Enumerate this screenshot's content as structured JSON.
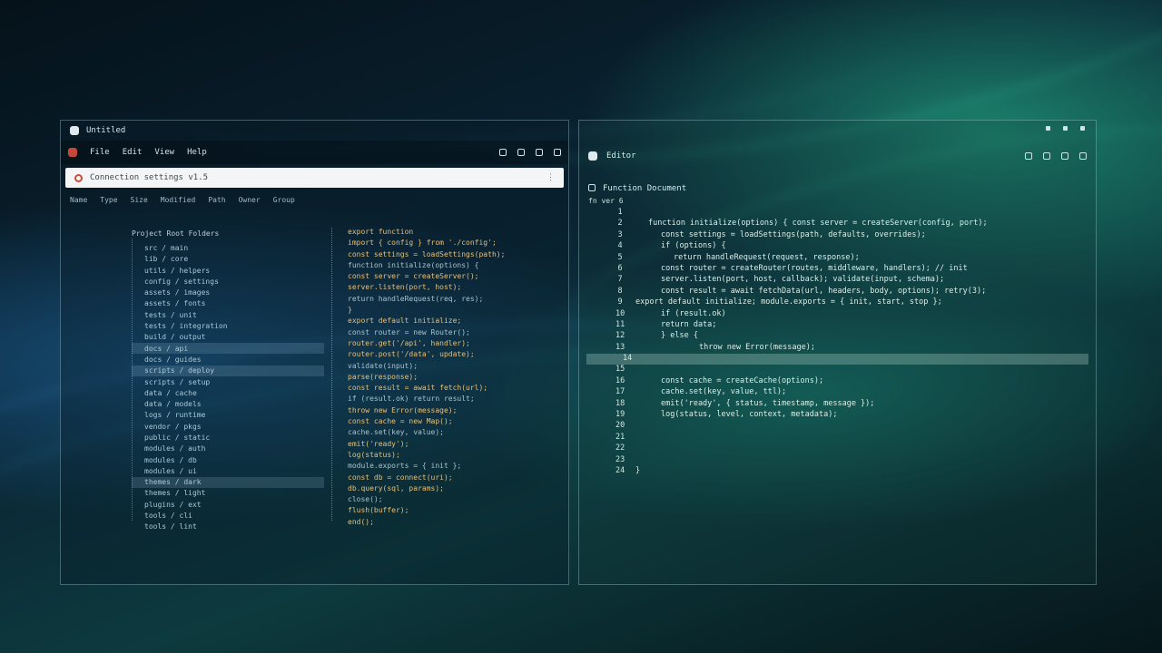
{
  "left_window": {
    "title": "Untitled",
    "menu": [
      "File",
      "Edit",
      "View",
      "Help"
    ],
    "address": "Connection settings   v1.5",
    "address_menu": "⋮",
    "toolbar": [
      "Name",
      "Type",
      "Size",
      "Modified",
      "Path",
      "Owner",
      "Group"
    ],
    "tree_header": "Project  Root  Folders",
    "tree_rows": [
      "src / main",
      "lib / core",
      "utils / helpers",
      "config / settings",
      "assets / images",
      "assets / fonts",
      "tests / unit",
      "tests / integration",
      "build / output",
      "docs / api",
      "docs / guides",
      "scripts / deploy",
      "scripts / setup",
      "data / cache",
      "data / models",
      "logs / runtime",
      "vendor / pkgs",
      "public / static",
      "modules / auth",
      "modules / db",
      "modules / ui",
      "themes / dark",
      "themes / light",
      "plugins / ext",
      "tools / cli",
      "tools / lint"
    ],
    "selected_tree_rows": [
      9,
      11,
      21
    ],
    "code_header": "export function",
    "code_lines": [
      "import { config } from './config';",
      "const settings = loadSettings(path);",
      "function initialize(options) {",
      "  const server = createServer();",
      "  server.listen(port, host);",
      "  return handleRequest(req, res);",
      "}",
      "export default initialize;",
      "const router = new Router();",
      "router.get('/api', handler);",
      "router.post('/data', update);",
      "  validate(input);",
      "  parse(response);",
      "  const result = await fetch(url);",
      "if (result.ok) return result;",
      "  throw new Error(message);",
      "const cache = new Map();",
      "cache.set(key, value);",
      "  emit('ready');",
      "  log(status);",
      "module.exports = { init };",
      "  const db = connect(uri);",
      "  db.query(sql, params);",
      "  close();",
      "  flush(buffer);",
      "end();"
    ]
  },
  "right_window": {
    "title": "Editor",
    "header": "Function   Document",
    "subheader": "fn  ver  6",
    "lines": [
      {
        "ln": "1",
        "indent": 0,
        "text": ""
      },
      {
        "ln": "2",
        "indent": 1,
        "text": "function initialize(options) { const server = createServer(config, port);"
      },
      {
        "ln": "3",
        "indent": 2,
        "text": "const settings = loadSettings(path, defaults, overrides);"
      },
      {
        "ln": "4",
        "indent": 2,
        "text": "if (options) {"
      },
      {
        "ln": "5",
        "indent": 3,
        "text": "return handleRequest(request, response);"
      },
      {
        "ln": "6",
        "indent": 2,
        "text": "const router = createRouter(routes, middleware, handlers); // init"
      },
      {
        "ln": "7",
        "indent": 2,
        "text": "server.listen(port, host, callback);   validate(input, schema);"
      },
      {
        "ln": "8",
        "indent": 2,
        "text": "const result = await fetchData(url, headers, body, options); retry(3);"
      },
      {
        "ln": "9",
        "indent": 0,
        "text": "export default initialize; module.exports = { init, start, stop };"
      },
      {
        "ln": "10",
        "indent": 2,
        "text": "if (result.ok)"
      },
      {
        "ln": "11",
        "indent": 2,
        "text": "return data;"
      },
      {
        "ln": "12",
        "indent": 2,
        "text": "} else {"
      },
      {
        "ln": "13",
        "indent": 5,
        "text": "throw new Error(message);"
      },
      {
        "ln": "14",
        "indent": 0,
        "text": ""
      },
      {
        "ln": "15",
        "indent": 0,
        "text": ""
      },
      {
        "ln": "16",
        "indent": 2,
        "text": "const cache = createCache(options);"
      },
      {
        "ln": "17",
        "indent": 2,
        "text": "cache.set(key, value, ttl);"
      },
      {
        "ln": "18",
        "indent": 2,
        "text": "emit('ready', { status, timestamp, message });"
      },
      {
        "ln": "19",
        "indent": 2,
        "text": "log(status, level, context, metadata);"
      },
      {
        "ln": "20",
        "indent": 0,
        "text": ""
      },
      {
        "ln": "21",
        "indent": 0,
        "text": ""
      },
      {
        "ln": "22",
        "indent": 0,
        "text": ""
      },
      {
        "ln": "23",
        "indent": 0,
        "text": ""
      },
      {
        "ln": "24",
        "indent": 0,
        "text": "}"
      }
    ],
    "selected_line": 13
  },
  "colors": {
    "accent_code": "#e5c07b",
    "tree_text": "#a9c9d9",
    "editor_text": "#dbeee9"
  }
}
